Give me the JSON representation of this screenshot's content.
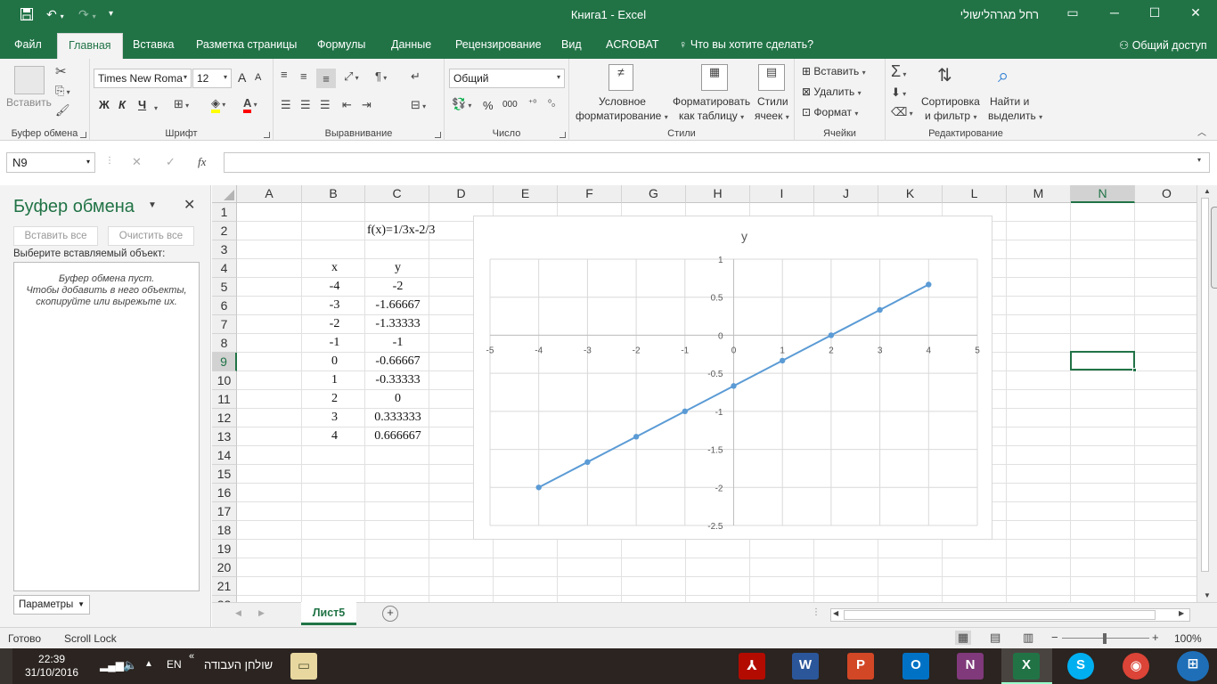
{
  "app": {
    "title": "Книга1  -  Excel",
    "user": "רחל מגרהלישולי",
    "share": "Общий доступ"
  },
  "tabs": [
    "Файл",
    "Главная",
    "Вставка",
    "Разметка страницы",
    "Формулы",
    "Данные",
    "Рецензирование",
    "Вид",
    "ACROBAT",
    "Что вы хотите сделать?"
  ],
  "ribbon": {
    "clipboard": {
      "paste": "Вставить",
      "group": "Буфер обмена"
    },
    "font": {
      "name": "Times New Roma",
      "size": "12",
      "bold": "Ж",
      "italic": "К",
      "underline": "Ч",
      "grow": "A",
      "shrink": "A",
      "group": "Шрифт"
    },
    "alignment": {
      "group": "Выравнивание"
    },
    "number": {
      "format": "Общий",
      "percent": "%",
      "thousands": "000",
      "group": "Число"
    },
    "styles": {
      "conditional_1": "Условное",
      "conditional_2": "форматирование",
      "table_1": "Форматировать",
      "table_2": "как таблицу",
      "cell_1": "Стили",
      "cell_2": "ячеек",
      "group": "Стили"
    },
    "cells": {
      "insert": "Вставить",
      "delete": "Удалить",
      "format": "Формат",
      "group": "Ячейки"
    },
    "editing": {
      "sort_1": "Сортировка",
      "sort_2": "и фильтр",
      "find_1": "Найти и",
      "find_2": "выделить",
      "group": "Редактирование"
    }
  },
  "formula_bar": {
    "name_box": "N9",
    "fx": "fx",
    "formula": ""
  },
  "clipboard_pane": {
    "title": "Буфер обмена",
    "paste_all": "Вставить все",
    "clear_all": "Очистить все",
    "select_label": "Выберите вставляемый объект:",
    "empty_1": "Буфер обмена пуст.",
    "empty_2": "Чтобы добавить в него объекты,",
    "empty_3": "скопируйте или вырежьте их.",
    "options": "Параметры"
  },
  "sheet": {
    "columns": [
      "A",
      "B",
      "C",
      "D",
      "E",
      "F",
      "G",
      "H",
      "I",
      "J",
      "K",
      "L",
      "M",
      "N",
      "O"
    ],
    "rows": [
      "1",
      "2",
      "3",
      "4",
      "5",
      "6",
      "7",
      "8",
      "9",
      "10",
      "11",
      "12",
      "13",
      "14",
      "15",
      "16",
      "17",
      "18",
      "19",
      "20",
      "21",
      "22"
    ],
    "selected_col": "N",
    "selected_row": "9",
    "cells": {
      "C2": "f(x)=1/3x-2/3",
      "B4": "x",
      "C4": "y",
      "B5": "-4",
      "C5": "-2",
      "B6": "-3",
      "C6": "-1.66667",
      "B7": "-2",
      "C7": "-1.33333",
      "B8": "-1",
      "C8": "-1",
      "B9": "0",
      "C9": "-0.66667",
      "B10": "1",
      "C10": "-0.33333",
      "B11": "2",
      "C11": "0",
      "B12": "3",
      "C12": "0.333333",
      "B13": "4",
      "C13": "0.666667"
    },
    "tab": "Лист5"
  },
  "chart_data": {
    "type": "scatter",
    "title": "y",
    "x": [
      -4,
      -3,
      -2,
      -1,
      0,
      1,
      2,
      3,
      4
    ],
    "series": [
      {
        "values": [
          -2,
          -1.66667,
          -1.33333,
          -1,
          -0.66667,
          -0.33333,
          0,
          0.333333,
          0.666667
        ]
      }
    ],
    "xlim": [
      -5,
      5
    ],
    "ylim": [
      -2.5,
      1
    ],
    "xticks": [
      "-5",
      "-4",
      "-3",
      "-2",
      "-1",
      "0",
      "1",
      "2",
      "3",
      "4",
      "5"
    ],
    "yticks": [
      "1",
      "0.5",
      "0",
      "-0.5",
      "-1",
      "-1.5",
      "-2",
      "-2.5"
    ],
    "grid": true,
    "color": "#5b9bd5"
  },
  "status": {
    "ready": "Готово",
    "scroll_lock": "Scroll Lock",
    "zoom": "100%"
  },
  "taskbar": {
    "time": "22:39",
    "date": "31/10/2016",
    "lang": "EN",
    "desktop": "שולחן העבודה"
  },
  "colors": {
    "accent": "#217346",
    "series": "#5b9bd5"
  }
}
